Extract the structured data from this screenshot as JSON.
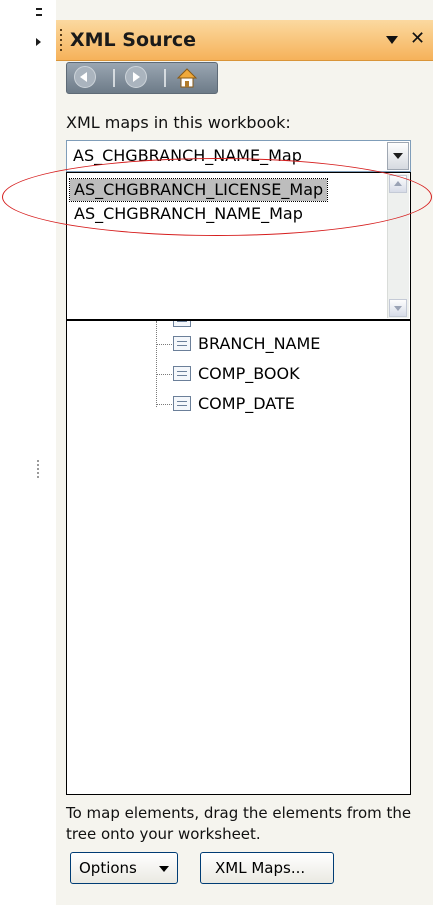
{
  "pane": {
    "title": "XML Source",
    "maps_label": "XML maps in this workbook:",
    "selected_map": "AS_CHGBRANCH_NAME_Map",
    "dropdown_options": [
      "AS_CHGBRANCH_LICENSE_Map",
      "AS_CHGBRANCH_NAME_Map"
    ],
    "highlighted_option": "AS_CHGBRANCH_LICENSE_Map",
    "tree_items": [
      "BRANCH_NAME",
      "COMP_BOOK",
      "COMP_DATE"
    ],
    "hint": "To map elements, drag the elements from the tree onto your worksheet.",
    "options_label": "Options",
    "xml_maps_label": "XML Maps..."
  },
  "icons": {
    "title_dropdown": "triangle-down-icon",
    "close": "close-icon",
    "back": "back-arrow-icon",
    "forward": "forward-arrow-icon",
    "home": "home-icon",
    "combo": "chevron-down-icon",
    "tree_leaf": "xml-element-icon"
  },
  "colors": {
    "title_bar": "#f6b25a",
    "pane_background": "#f5f4ee",
    "annotation": "#d61f1f"
  }
}
